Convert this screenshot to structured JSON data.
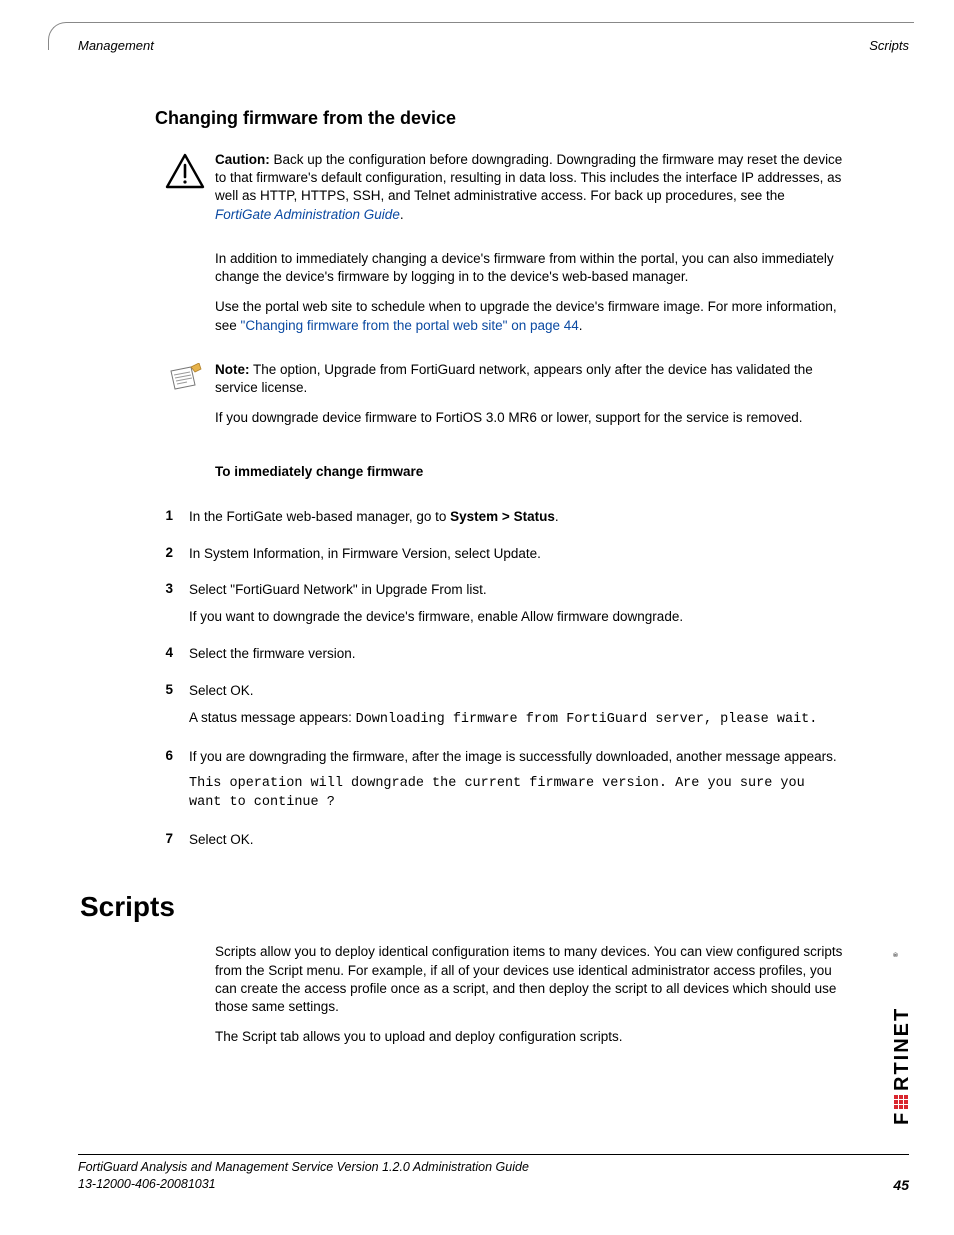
{
  "header": {
    "left": "Management",
    "right": "Scripts"
  },
  "section_heading": "Changing firmware from the device",
  "caution": {
    "label": "Caution:",
    "text": " Back up the configuration before downgrading. Downgrading the firmware may reset the device to that firmware's default configuration, resulting in data loss. This includes the interface IP addresses, as well as HTTP, HTTPS, SSH, and Telnet administrative access. For back up procedures, see the ",
    "link": "FortiGate Administration Guide",
    "tail": "."
  },
  "para1": "In addition to immediately changing a device's firmware from within the portal, you can also immediately change the device's firmware by logging in to the device's web-based manager.",
  "para2_a": "Use the portal web site to schedule when to upgrade the device's firmware image. For more information, see ",
  "para2_link": "\"Changing firmware from the portal web site\" on page 44",
  "para2_b": ".",
  "note": {
    "label": "Note:",
    "text": " The option, Upgrade from FortiGuard network, appears only after the device has validated the service license.",
    "para2": "If you downgrade device firmware to FortiOS 3.0 MR6 or lower, support for the service is removed."
  },
  "proc_heading": "To immediately change firmware",
  "steps": {
    "s1": {
      "n": "1",
      "a": "In the FortiGate web-based manager, go to ",
      "b": "System > Status",
      "c": "."
    },
    "s2": {
      "n": "2",
      "t": "In System Information, in Firmware Version, select Update."
    },
    "s3": {
      "n": "3",
      "t": "Select \"FortiGuard Network\" in Upgrade From list.",
      "p": "If you want to downgrade the device's firmware, enable Allow firmware downgrade."
    },
    "s4": {
      "n": "4",
      "t": "Select the firmware version."
    },
    "s5": {
      "n": "5",
      "t": "Select OK.",
      "p_a": "A status message appears: ",
      "p_code": "Downloading firmware from FortiGuard server, please wait."
    },
    "s6": {
      "n": "6",
      "t": "If you are downgrading the firmware, after the image is successfully downloaded, another message appears.",
      "code": "This operation will downgrade the current firmware version. Are you sure you want to continue ?"
    },
    "s7": {
      "n": "7",
      "t": "Select OK."
    }
  },
  "h1": "Scripts",
  "scripts_p1": "Scripts allow you to deploy identical configuration items to many devices. You can view configured scripts from the Script menu. For example, if all of your devices use identical administrator access profiles, you can create the access profile once as a script, and then deploy the script to all devices which should use those same settings.",
  "scripts_p2": "The Script tab allows you to upload and deploy configuration scripts.",
  "footer": {
    "line1": "FortiGuard Analysis and Management Service Version 1.2.0 Administration Guide",
    "line2": "13-12000-406-20081031",
    "page": "45"
  },
  "brand": "FORTINET"
}
